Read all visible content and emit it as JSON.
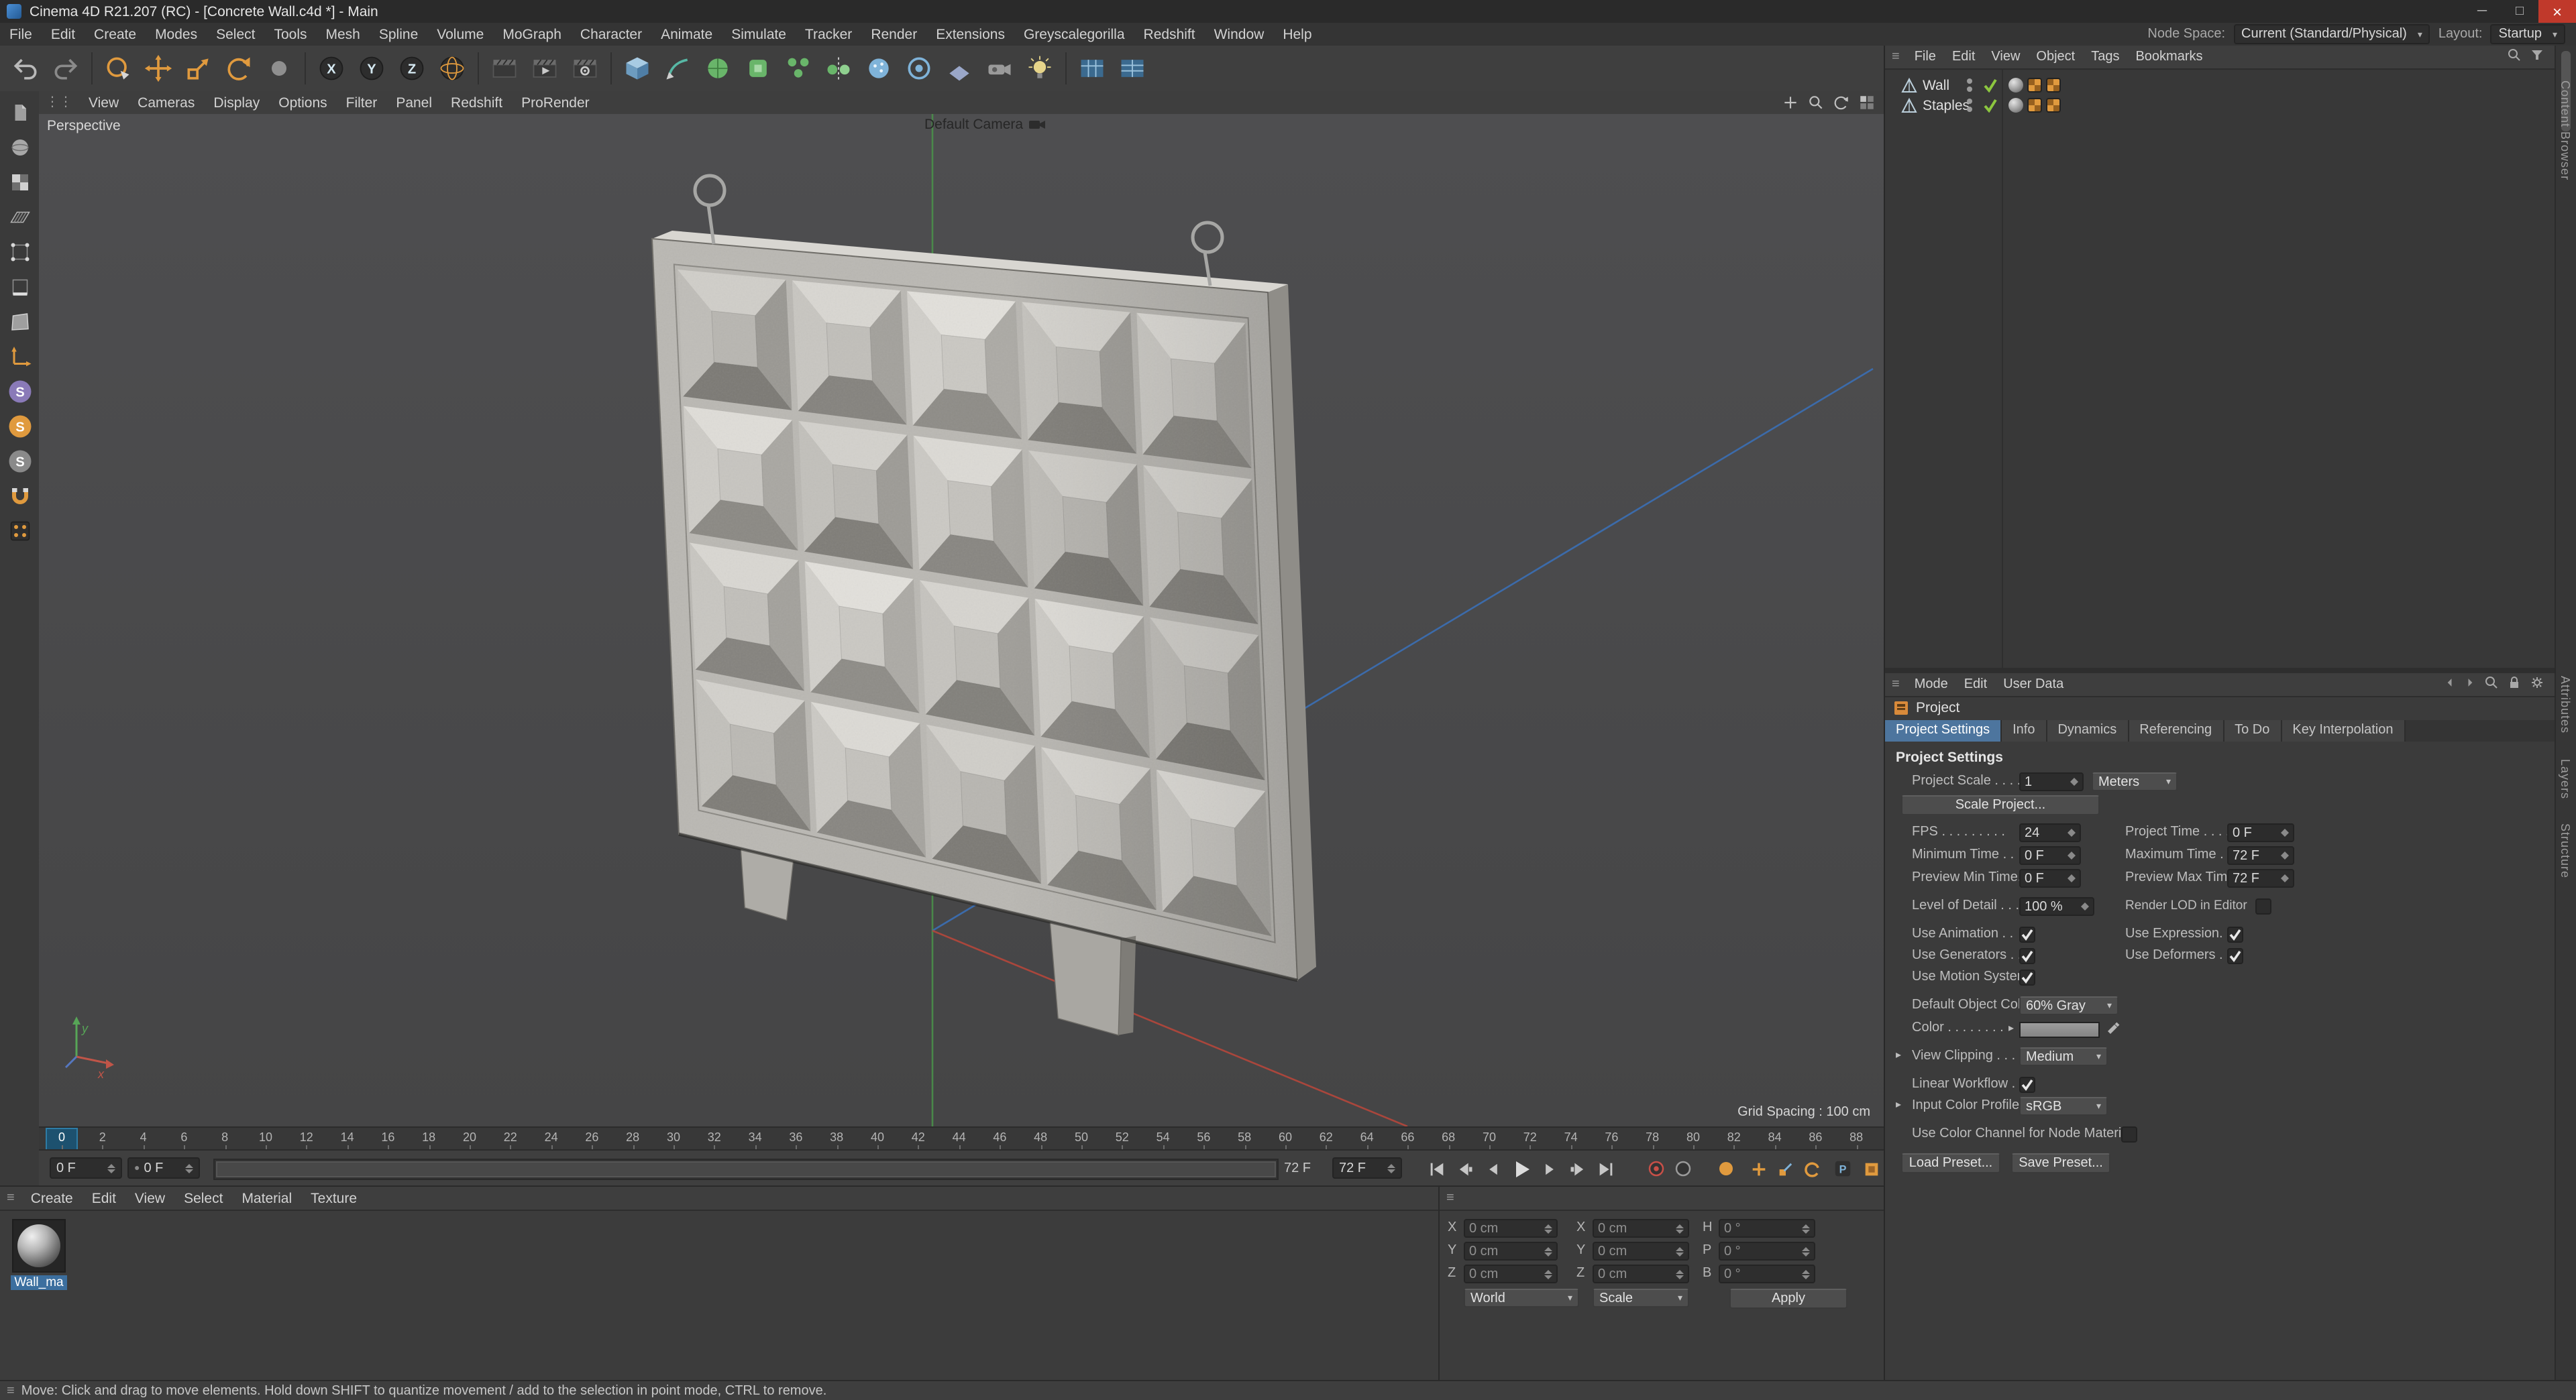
{
  "window": {
    "title": "Cinema 4D R21.207 (RC) - [Concrete Wall.c4d *] - Main",
    "minimize": "─",
    "maximize": "□",
    "close": "×"
  },
  "menubar": {
    "items": [
      "File",
      "Edit",
      "Create",
      "Modes",
      "Select",
      "Tools",
      "Mesh",
      "Spline",
      "Volume",
      "MoGraph",
      "Character",
      "Animate",
      "Simulate",
      "Tracker",
      "Render",
      "Extensions",
      "Greyscalegorilla",
      "Redshift",
      "Window",
      "Help"
    ],
    "node_space_label": "Node Space:",
    "node_space_value": "Current (Standard/Physical)",
    "layout_label": "Layout:",
    "layout_value": "Startup"
  },
  "toolbar": {
    "icons": [
      "undo",
      "redo",
      "|",
      "live-selection",
      "move-tool",
      "scale-tool",
      "rotate-tool",
      "last-tool",
      "|",
      "lock-x-axis",
      "lock-y-axis",
      "lock-z-axis",
      "coordinate-system",
      "|",
      "render-view",
      "render-region",
      "render-settings",
      "|",
      "add-cube",
      "add-pen",
      "add-subdivision",
      "add-extrude",
      "add-array",
      "add-symmetry",
      "add-volume",
      "add-field",
      "add-floor",
      "add-camera",
      "add-light",
      "|",
      "snap-settings",
      "workplane-settings"
    ]
  },
  "left_toolbar": {
    "icons": [
      "make-editable",
      "model-mode",
      "texture-mode",
      "workplane-mode",
      "points-mode",
      "edges-mode",
      "polygons-mode",
      "enable-axis",
      "viewport-solo-off",
      "viewport-solo-single",
      "viewport-solo-hierarchy",
      "enable-snap",
      "quantize"
    ]
  },
  "viewport": {
    "menus": [
      "View",
      "Cameras",
      "Display",
      "Options",
      "Filter",
      "Panel",
      "Redshift",
      "ProRender"
    ],
    "nav_icons": [
      "pan-view",
      "zoom-view",
      "rotate-view",
      "toggle-views"
    ],
    "view_name": "Perspective",
    "camera_label": "Default Camera",
    "grid_spacing": "Grid Spacing : 100 cm"
  },
  "timeline": {
    "tick_start": 0,
    "tick_end": 88,
    "tick_step": 2,
    "current_frame": 0,
    "current_value": "0 F",
    "start_value": "0 F",
    "preview_end_label": "72 F",
    "max_value": "72 F",
    "transport": [
      "goto-start",
      "prev-key",
      "prev-frame",
      "play",
      "next-frame",
      "next-key",
      "goto-end"
    ],
    "keying": [
      "record-keyframe",
      "autokeying",
      "keyframe-selection",
      "key-position",
      "key-scale",
      "key-rotation",
      "key-parameter",
      "key-pla",
      "timeline-grid"
    ]
  },
  "materials": {
    "menus": [
      "Create",
      "Edit",
      "View",
      "Select",
      "Material",
      "Texture"
    ],
    "items": [
      {
        "name": "Wall_ma"
      }
    ]
  },
  "coordinates": {
    "rows": [
      {
        "l1": "X",
        "v1": "0 cm",
        "l2": "X",
        "v2": "0 cm",
        "l3": "H",
        "v3": "0 °"
      },
      {
        "l1": "Y",
        "v1": "0 cm",
        "l2": "Y",
        "v2": "0 cm",
        "l3": "P",
        "v3": "0 °"
      },
      {
        "l1": "Z",
        "v1": "0 cm",
        "l2": "Z",
        "v2": "0 cm",
        "l3": "B",
        "v3": "0 °"
      }
    ],
    "system": "World",
    "mode": "Scale",
    "apply": "Apply"
  },
  "object_manager": {
    "menus": [
      "File",
      "Edit",
      "View",
      "Object",
      "Tags",
      "Bookmarks"
    ],
    "objects": [
      {
        "name": "Wall",
        "tags": [
          "phong",
          "texture",
          "texture"
        ]
      },
      {
        "name": "Staples",
        "tags": [
          "phong",
          "texture",
          "texture"
        ]
      }
    ]
  },
  "attributes": {
    "menus": [
      "Mode",
      "Edit",
      "User Data"
    ],
    "object_label": "Project",
    "tabs": [
      "Project Settings",
      "Info",
      "Dynamics",
      "Referencing",
      "To Do",
      "Key Interpolation"
    ],
    "active_tab": "Project Settings",
    "section_title": "Project Settings",
    "labels": {
      "project_scale": "Project Scale . . . .",
      "fps": "FPS . . . . . . . . .",
      "project_time": "Project Time . . . .",
      "minimum_time": "Minimum Time . .",
      "maximum_time": "Maximum Time . .",
      "preview_min": "Preview Min Time. .",
      "preview_max": "Preview Max Time .",
      "lod": "Level of Detail . . .",
      "render_lod": "Render LOD in Editor",
      "use_animation": "Use Animation . .",
      "use_expression": "Use Expression. . .",
      "use_generators": "Use Generators . .",
      "use_deformers": "Use Deformers . .",
      "use_motion": "Use Motion System",
      "default_color": "Default Object Color",
      "color": "Color . . . . . . . .",
      "view_clipping": "View Clipping . . .",
      "linear_workflow": "Linear Workflow . .",
      "input_profile": "Input Color Profile .",
      "node_material": "Use Color Channel for Node Material"
    },
    "values": {
      "project_scale": "1",
      "project_scale_unit": "Meters",
      "fps": "24",
      "project_time": "0 F",
      "minimum_time": "0 F",
      "maximum_time": "72 F",
      "preview_min": "0 F",
      "preview_max": "72 F",
      "lod": "100 %",
      "default_color": "60% Gray",
      "view_clipping": "Medium",
      "input_profile": "sRGB"
    },
    "checks": {
      "render_lod": false,
      "use_animation": true,
      "use_expression": true,
      "use_generators": true,
      "use_deformers": true,
      "use_motion": true,
      "linear_workflow": true,
      "node_material": false
    },
    "buttons": {
      "scale_project": "Scale Project...",
      "load_preset": "Load Preset...",
      "save_preset": "Save Preset..."
    }
  },
  "side_tabs": [
    "Content Browser",
    "Attributes",
    "Layers",
    "Structure"
  ],
  "status": {
    "text": "Move: Click and drag to move elements. Hold down SHIFT to quantize movement / add to the selection in point mode, CTRL to remove."
  },
  "colors": {
    "accent_blue": "#4d759e",
    "accent_orange": "#e09a3e",
    "viewport_bg": "#4b4b4d",
    "selection_blue": "#3c6f9f"
  }
}
